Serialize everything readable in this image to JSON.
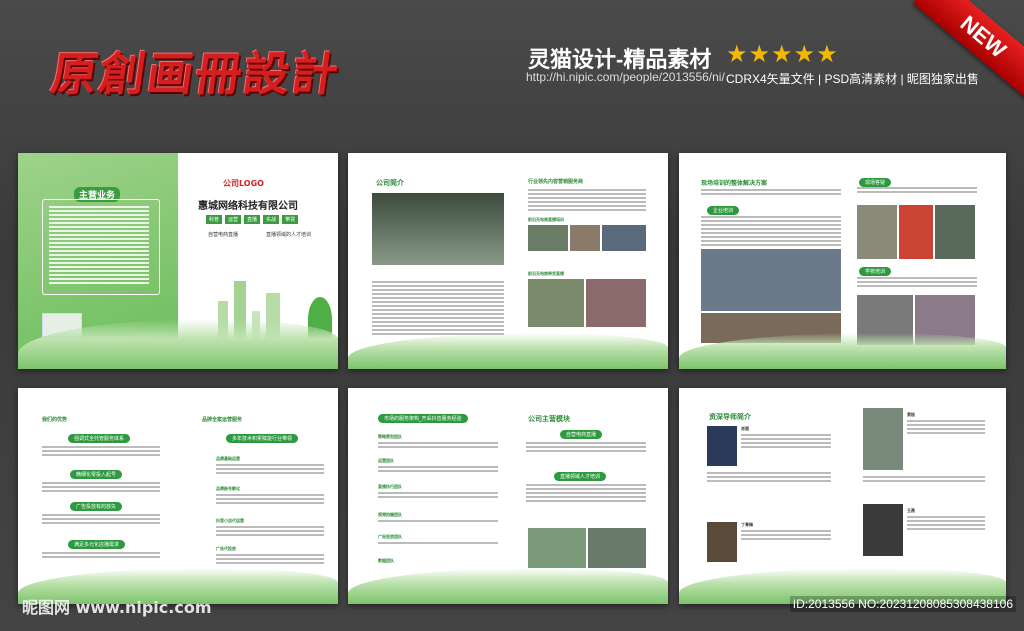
{
  "banner": {
    "main_title": "原創画冊設計",
    "brand_title": "灵猫设计-精品素材",
    "url": "http://hi.nipic.com/people/2013556/ni/",
    "stars": "★★★★★",
    "features": "CDRX4矢量文件 | PSD高清素材 | 昵图独家出售",
    "new_badge": "NEW"
  },
  "page1": {
    "main_business": "主营业务",
    "logo": "公司LOGO",
    "company": "惠城网络科技有限公司",
    "tags": [
      "科普",
      "运营",
      "直播",
      "实战",
      "带货"
    ],
    "bullets": [
      "自营电商直播",
      "直播领域的人才培训"
    ],
    "footer_company": "惠州惠城网络科技有限公司"
  },
  "page2": {
    "title": "公司简介"
  },
  "page3": {
    "title": "行业领先内容营销服务商",
    "sub1": "前沿无电商直播培训",
    "sub2": "前沿无电商带货直播"
  },
  "page4": {
    "title": "现场培训的整体解决方案",
    "sub": "企业培训"
  },
  "page5": {
    "title": "现场答疑",
    "sub": "学校培训"
  },
  "page6": {
    "title": "我们的优势",
    "items": [
      "强调式全托管服务体系",
      "精细化零投入起号",
      "广告投放有的放矢",
      "满足多元化店播需求"
    ]
  },
  "page7": {
    "title": "品牌全案运营服务",
    "headline": "多年技术积累赋能行业带领",
    "items": [
      "品牌基础运营",
      "品牌账号孵化",
      "抖音小店代运营",
      "广告代投放"
    ]
  },
  "page8": {
    "title": "市场的服务架构_开采抖音服务经验",
    "teams": [
      "策略策划团队",
      "运营团队",
      "直播执行团队",
      "视频拍摄团队",
      "广告投放团队",
      "数据团队"
    ]
  },
  "page9": {
    "title": "公司主营模块",
    "items": [
      "自营电商直播",
      "直播领域人才培训"
    ]
  },
  "page10": {
    "title": "资深导师简介",
    "names": [
      "肖丽",
      "黄桂",
      "丁青梅",
      "王燕"
    ]
  },
  "footer": {
    "watermark_left": "昵图网 www.nipic.com",
    "id_text": "ID:2013556 NO:20231208085308438106"
  }
}
